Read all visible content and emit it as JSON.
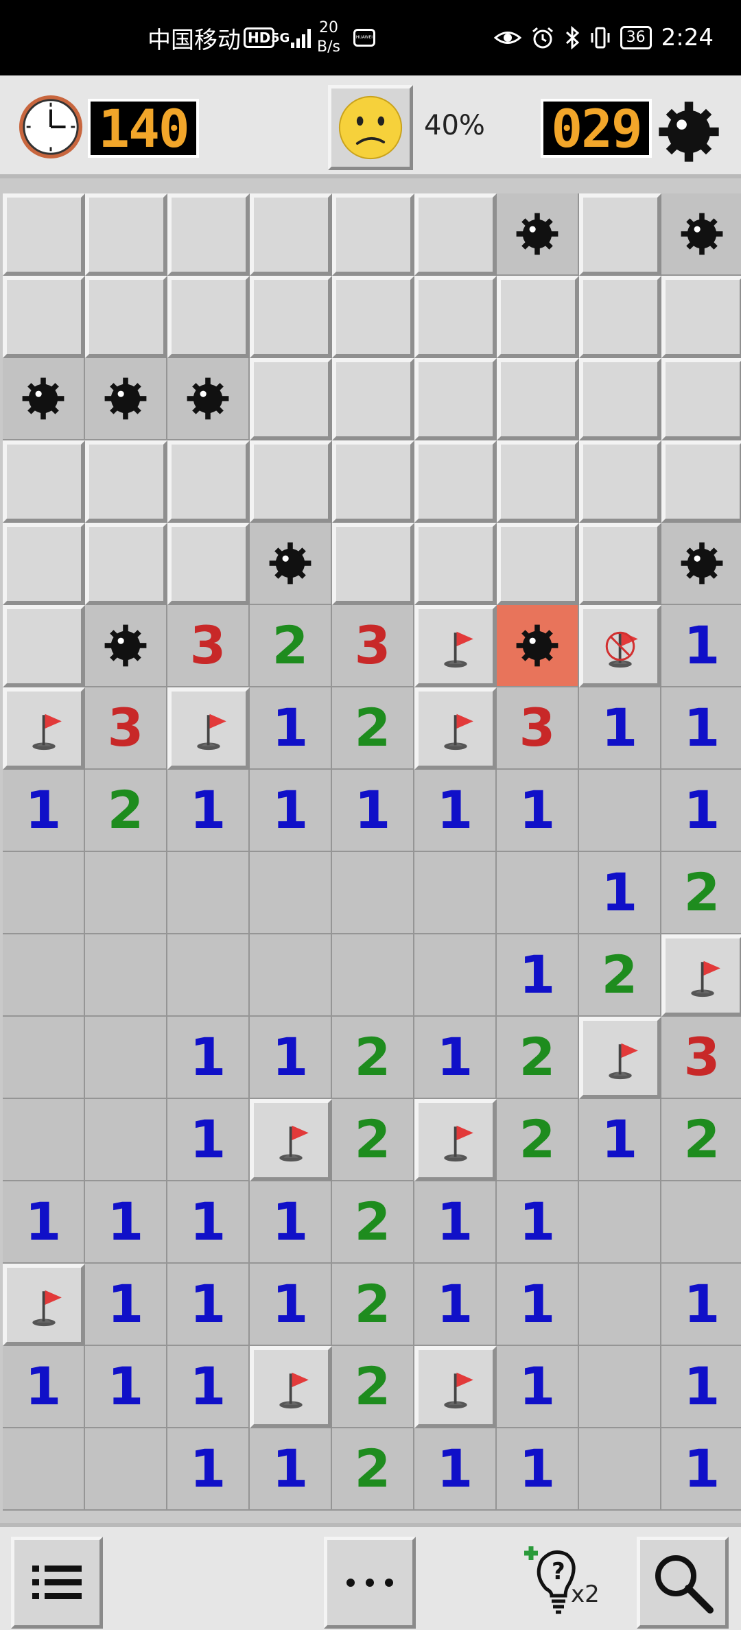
{
  "status_bar": {
    "carrier": "中国移动",
    "hd": "HD",
    "network": "5G",
    "speed_value": "20",
    "speed_unit": "B/s",
    "huawei": "HUAWEI",
    "battery": "36",
    "time": "2:24"
  },
  "game": {
    "timer": "140",
    "mines_left": "029",
    "progress": "40%",
    "face": "worried-face-icon"
  },
  "board": {
    "rows": 16,
    "cols": 9,
    "legend": "# = covered, F = flag, M = mine, X = exploded mine, W = wrong flag, 0 = empty, 1-3 = number",
    "cells": [
      "######M#M",
      "#########",
      "MMM######",
      "#########",
      "###M####M",
      "#M323FXW1",
      "F3F12F311",
      "1211111 1",
      "       12",
      "      12F",
      "  11212F3",
      "  1F2F212",
      "1111211  ",
      "F111211 1",
      "111F2F1 1",
      "  11211 1"
    ],
    "colors": {
      "1": "#1010c8",
      "2": "#1e8c1e",
      "3": "#c82828",
      "exploded": "#e8745b",
      "lcd_digits": "#f2a62a"
    }
  },
  "bottom": {
    "hint_count": "x2",
    "menu_icon": "list-icon",
    "more_icon": "ellipsis-icon",
    "search_icon": "magnifier-icon",
    "hint_icon": "lightbulb-hint-icon"
  }
}
